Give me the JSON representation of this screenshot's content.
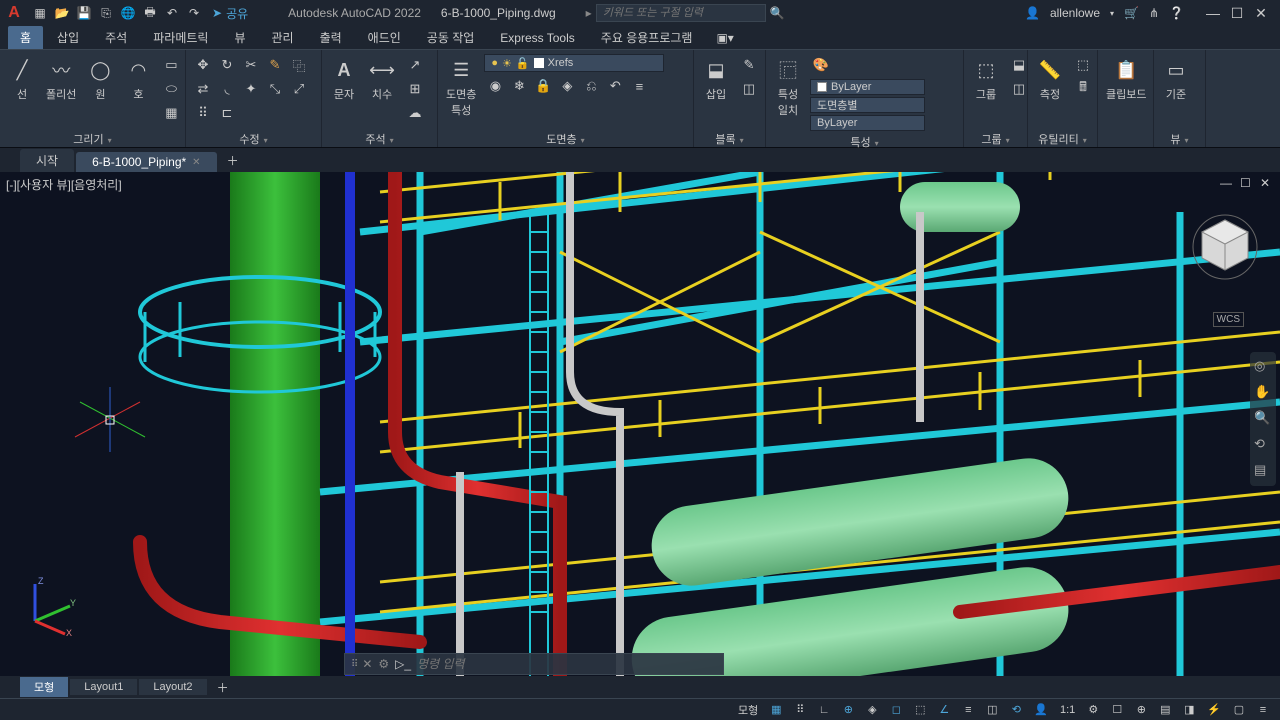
{
  "titlebar": {
    "share": "공유",
    "app": "Autodesk AutoCAD 2022",
    "file": "6-B-1000_Piping.dwg",
    "search_placeholder": "키워드 또는 구절 입력",
    "user": "allenlowe"
  },
  "ribbon_tabs": [
    "홈",
    "삽입",
    "주석",
    "파라메트릭",
    "뷰",
    "관리",
    "출력",
    "애드인",
    "공동 작업",
    "Express Tools",
    "주요 응용프로그램"
  ],
  "panels": {
    "draw": {
      "label": "그리기",
      "line": "선",
      "polyline": "폴리선",
      "circle": "원",
      "arc": "호"
    },
    "modify": {
      "label": "수정"
    },
    "annot": {
      "label": "주석",
      "text": "문자",
      "dim": "치수"
    },
    "layers": {
      "label": "도면층",
      "props": "도면층\n특성",
      "current": "Xrefs"
    },
    "block": {
      "label": "블록",
      "insert": "삽입"
    },
    "props": {
      "label": "특성",
      "match": "특성\n일치",
      "layer": "ByLayer",
      "bylayer2": "도면층별",
      "bylayer3": "ByLayer"
    },
    "group": {
      "label": "그룹",
      "btn": "그룹"
    },
    "util": {
      "label": "유틸리티",
      "measure": "측정"
    },
    "clip": {
      "label": "클립보드"
    },
    "view": {
      "label": "뷰",
      "base": "기준"
    }
  },
  "file_tabs": {
    "start": "시작",
    "active": "6-B-1000_Piping*"
  },
  "viewport": {
    "label": "[-][사용자 뷰][음영처리]",
    "wcs": "WCS",
    "axes": {
      "x": "X",
      "y": "Y",
      "z": "Z"
    }
  },
  "cmd": {
    "placeholder": "명령 입력"
  },
  "layout_tabs": {
    "model": "모형",
    "l1": "Layout1",
    "l2": "Layout2"
  },
  "status": {
    "model": "모형",
    "scale": "1:1"
  }
}
